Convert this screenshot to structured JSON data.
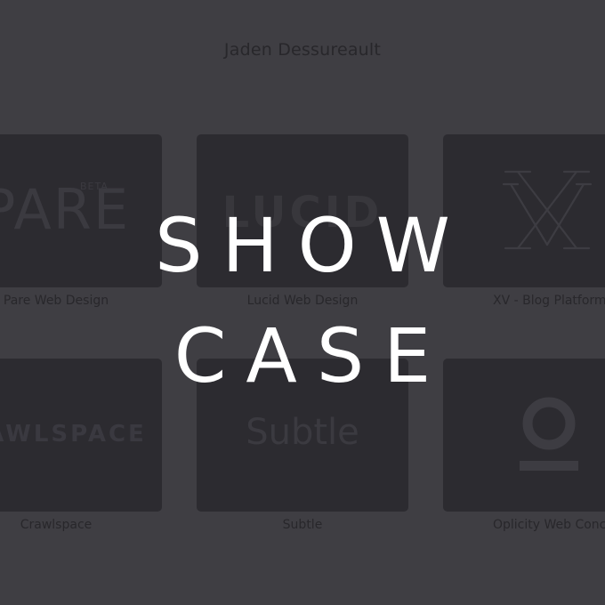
{
  "header": {
    "author_name": "Jaden Dessureault"
  },
  "projects": [
    {
      "title": "Pare Web Design",
      "logo_text": "PARE",
      "badge": "BETA"
    },
    {
      "title": "Lucid Web Design",
      "logo_text": "LUCID"
    },
    {
      "title": "XV - Blog Platform"
    },
    {
      "title": "Crawlspace",
      "logo_text": "RAWLSPACE"
    },
    {
      "title": "Subtle",
      "logo_text": "Subtle"
    },
    {
      "title": "Oplicity Web Conce"
    }
  ],
  "overlay": {
    "line1": "SHOW",
    "line2": "CASE",
    "color": "#ffffff"
  },
  "colors": {
    "background": "#3f3e43",
    "tile": "#2c2b30",
    "muted_text": "#28272b"
  }
}
